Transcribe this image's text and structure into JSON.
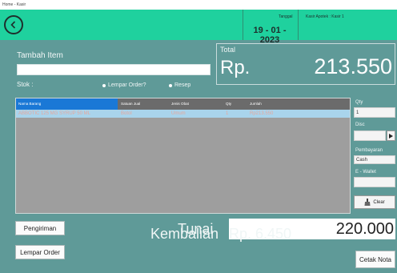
{
  "window": {
    "title": "Home - Kasir"
  },
  "header": {
    "date_label": "Tanggal",
    "date_value": "19 - 01 - 2023",
    "cashier_label": "Kasir Apotek : Kasir 1"
  },
  "tambah_item": {
    "label": "Tambah Item",
    "value": ""
  },
  "total": {
    "label": "Total",
    "currency": "Rp.",
    "amount": "213.550"
  },
  "stok": {
    "label": "Stok :",
    "options": [
      "Lempar Order?",
      "Resep"
    ]
  },
  "table": {
    "columns": [
      "Nama Barang",
      "Satuan Jual",
      "Jenis Obat",
      "Qty",
      "Jumlah"
    ],
    "rows": [
      [
        "ABBOTIC 125 MG SYRUP 50 ML",
        "Botol",
        "Umum",
        "1",
        "Rp213.550"
      ]
    ]
  },
  "side": {
    "qty_label": "Qty",
    "qty_value": "1",
    "disc_label": "Disc",
    "disc_value": "",
    "payment_label": "Pembayaran",
    "payment_value": "Cash",
    "ewallet_label": "E - Wallet",
    "ewallet_value": "",
    "clear_label": "Clear"
  },
  "actions": {
    "pengiriman": "Pengiriman",
    "lempar_order": "Lempar Order",
    "cetak_nota": "Cetak Nota"
  },
  "payment": {
    "tunai_label": "Tunai",
    "tunai_value": "220.000",
    "kembalian_label": "Kembalian",
    "kembalian_value": "Rp. 6.450"
  },
  "colors": {
    "background": "#5f9a98",
    "header": "#1fd19e",
    "table_header": "#6b6b6b",
    "table_header_selected": "#1a78d6",
    "row_selected": "#a9d4ec"
  },
  "icons": [
    "back-arrow-icon",
    "dropdown-arrow-icon",
    "clear-brush-icon"
  ]
}
